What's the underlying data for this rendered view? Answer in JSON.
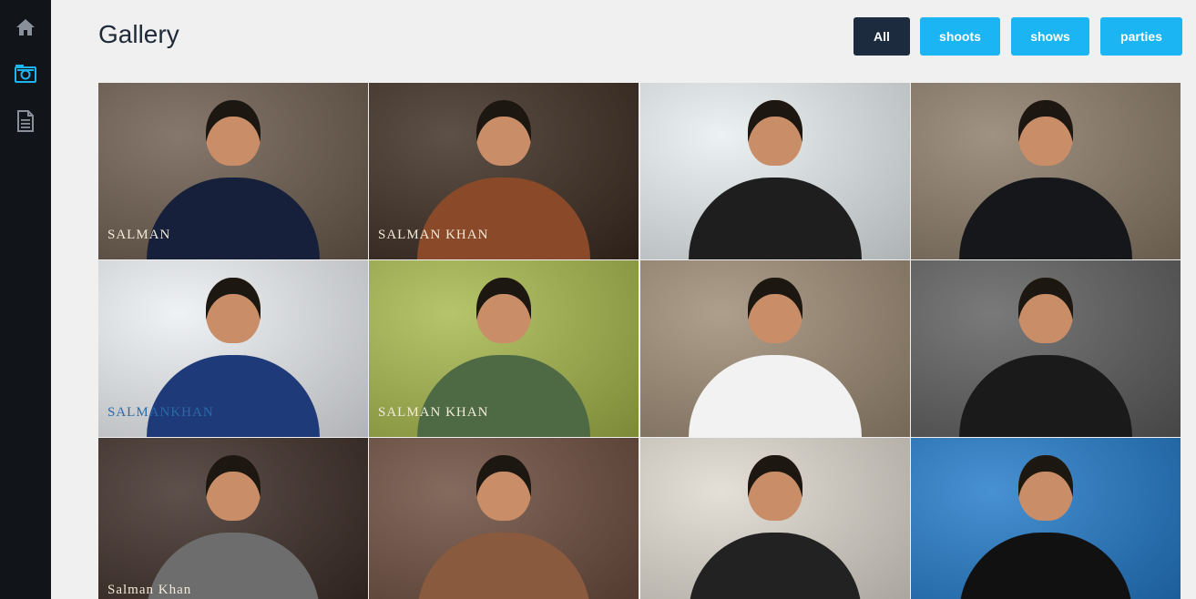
{
  "sidebar": {
    "items": [
      {
        "name": "home",
        "icon": "home-icon",
        "active": false
      },
      {
        "name": "gallery",
        "icon": "camera-icon",
        "active": true
      },
      {
        "name": "documents",
        "icon": "document-icon",
        "active": false
      }
    ]
  },
  "header": {
    "title": "Gallery"
  },
  "filters": [
    {
      "label": "All",
      "active": true
    },
    {
      "label": "shoots",
      "active": false
    },
    {
      "label": "shows",
      "active": false
    },
    {
      "label": "parties",
      "active": false
    }
  ],
  "colors": {
    "sidebar_bg": "#111418",
    "active_icon": "#1ab5f2",
    "inactive_icon": "#8a9099",
    "filter_active": "#1d2b3e",
    "filter_default": "#1ab5f2",
    "page_bg": "#f0f0f0"
  },
  "gallery": {
    "photos": [
      {
        "caption": "SALMAN",
        "bg": "#6b5a4c",
        "outfit": "#16203a"
      },
      {
        "caption": "SALMAN KHAN",
        "bg": "#3a2a1f",
        "outfit": "#8a4a2a"
      },
      {
        "caption": "",
        "bg": "#e8eef0",
        "outfit": "#1e1e1e"
      },
      {
        "caption": "",
        "bg": "#8a7a66",
        "outfit": "#15171b"
      },
      {
        "caption": "SALMANKHAN",
        "bg": "#eceff2",
        "outfit": "#1f3a78"
      },
      {
        "caption": "SALMAN KHAN",
        "bg": "#a6b84a",
        "outfit": "#4e6a45"
      },
      {
        "caption": "",
        "bg": "#9c8a72",
        "outfit": "#f2f2f2"
      },
      {
        "caption": "",
        "bg": "#5c5c5c",
        "outfit": "#1a1a1a"
      },
      {
        "caption": "Salman Khan",
        "bg": "#3a2a24",
        "outfit": "#6d6d6d"
      },
      {
        "caption": "",
        "bg": "#6a4a3a",
        "outfit": "#8a5a3e"
      },
      {
        "caption": "",
        "bg": "#ded9cf",
        "outfit": "#222222"
      },
      {
        "caption": "",
        "bg": "#1f78c8",
        "outfit": "#111111"
      }
    ]
  }
}
